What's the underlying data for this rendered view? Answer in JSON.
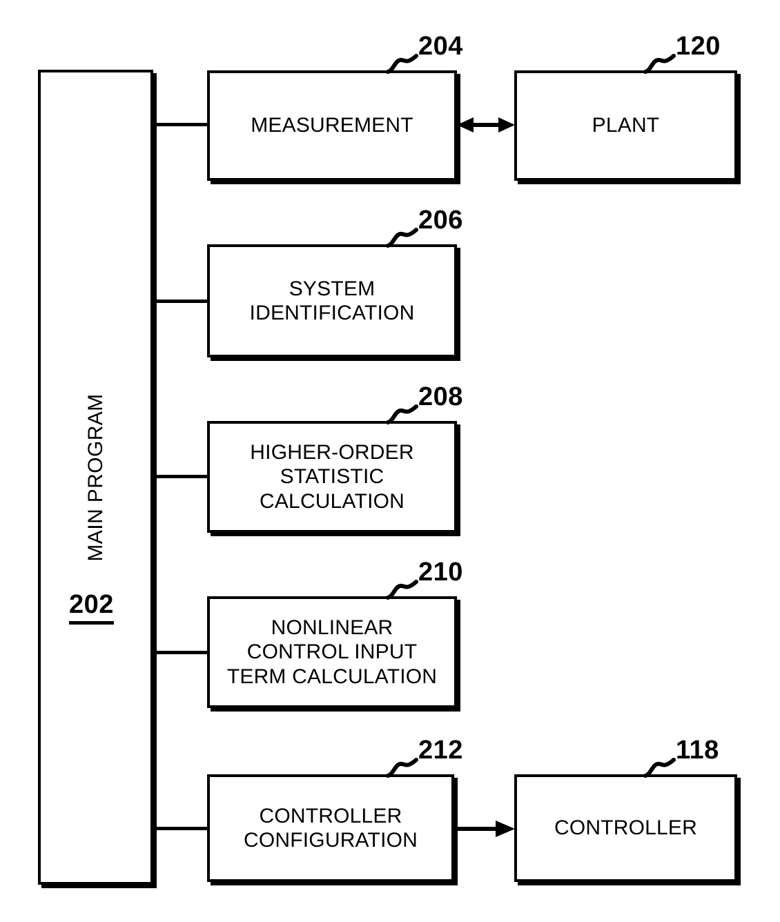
{
  "figure": {
    "type": "patent-block-diagram",
    "background_color": "#ffffff",
    "line_color": "#000000"
  },
  "main_program": {
    "label": "MAIN PROGRAM",
    "ref": "202"
  },
  "blocks": [
    {
      "id": "measurement",
      "label": "MEASUREMENT",
      "ref": "204"
    },
    {
      "id": "plant",
      "label": "PLANT",
      "ref": "120"
    },
    {
      "id": "system_identification",
      "label": "SYSTEM\nIDENTIFICATION",
      "ref": "206"
    },
    {
      "id": "higher_order_statistic",
      "label": "HIGHER-ORDER\nSTATISTIC\nCALCULATION",
      "ref": "208"
    },
    {
      "id": "nonlinear_control_input",
      "label": "NONLINEAR\nCONTROL INPUT\nTERM CALCULATION",
      "ref": "210"
    },
    {
      "id": "controller_configuration",
      "label": "CONTROLLER\nCONFIGURATION",
      "ref": "212"
    },
    {
      "id": "controller",
      "label": "CONTROLLER",
      "ref": "118"
    }
  ],
  "connectors": [
    {
      "id": "bar-to-measurement",
      "kind": "line"
    },
    {
      "id": "bar-to-sysid",
      "kind": "line"
    },
    {
      "id": "bar-to-hos",
      "kind": "line"
    },
    {
      "id": "bar-to-nonlinear",
      "kind": "line"
    },
    {
      "id": "bar-to-ctrlconfig",
      "kind": "line"
    },
    {
      "id": "measurement-plant",
      "kind": "double-arrow"
    },
    {
      "id": "ctrlconfig-controller",
      "kind": "single-arrow"
    }
  ]
}
